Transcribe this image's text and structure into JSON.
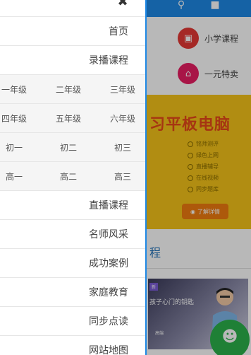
{
  "drawer": {
    "close_icon": "close-icon",
    "menu_top": [
      {
        "label": "首页"
      },
      {
        "label": "录播课程"
      }
    ],
    "grades": [
      [
        "一年级",
        "二年级",
        "三年级"
      ],
      [
        "四年级",
        "五年级",
        "六年级"
      ],
      [
        "初一",
        "初二",
        "初三"
      ],
      [
        "高一",
        "高二",
        "高三"
      ]
    ],
    "menu_bottom": [
      {
        "label": "直播课程"
      },
      {
        "label": "名师风采"
      },
      {
        "label": "成功案例"
      },
      {
        "label": "家庭教育"
      },
      {
        "label": "同步点读"
      },
      {
        "label": "网站地图"
      }
    ]
  },
  "background": {
    "header_icons": [
      "search-icon",
      "user-icon"
    ],
    "categories": [
      {
        "label": "小学课程",
        "icon": "book-icon",
        "color": "#e53935"
      },
      {
        "label": "一元特卖",
        "icon": "bank-icon",
        "color": "#e91e63"
      }
    ],
    "banner": {
      "title": "习平板电脑",
      "features": [
        "铭师测评",
        "绿色上网",
        "直播辅导",
        "在线视频",
        "同步题库"
      ],
      "button_label": "了解详情"
    },
    "section_title": "程",
    "card": {
      "tag": "新",
      "text": "孩子心门的钥匙",
      "sub": "高端"
    },
    "chat_icon": "chat-icon"
  }
}
